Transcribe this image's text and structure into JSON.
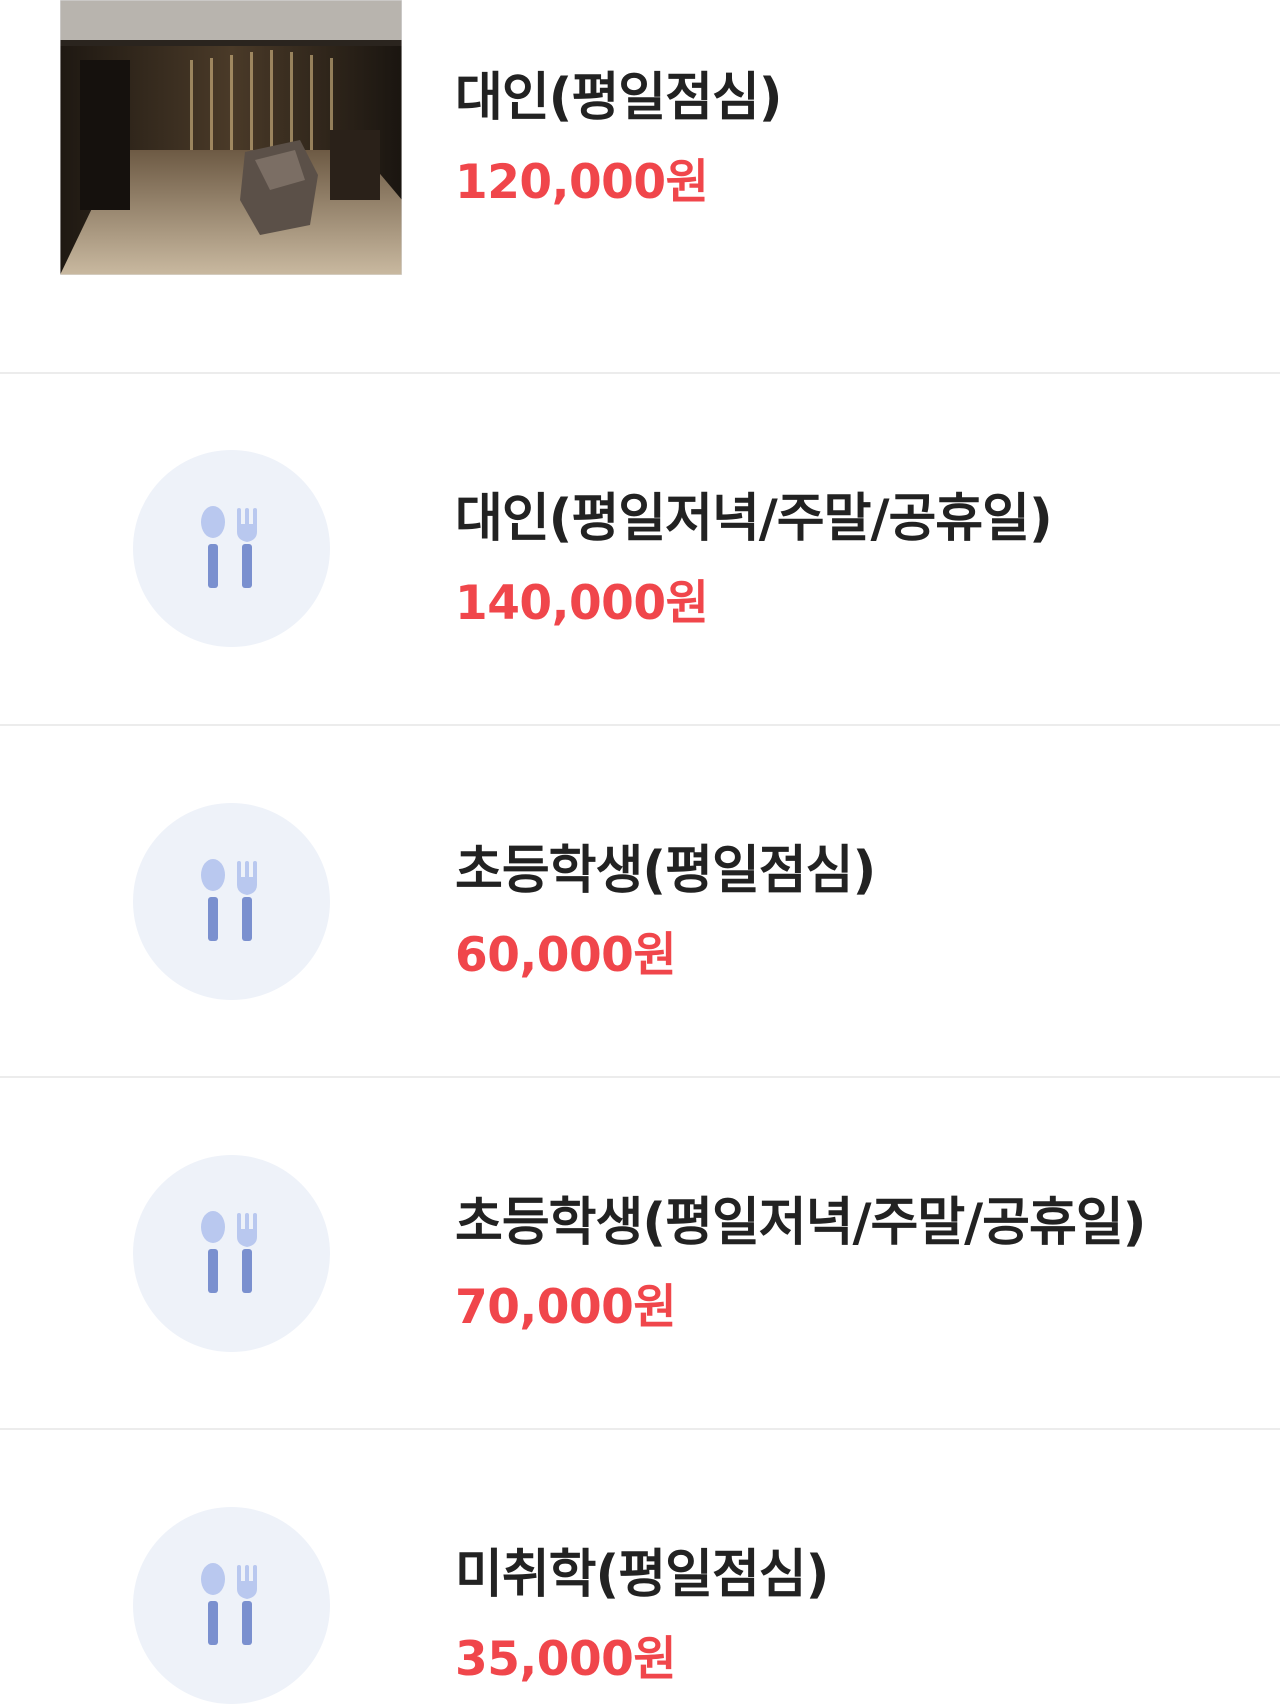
{
  "menu": {
    "currency_suffix": "원",
    "colors": {
      "name_text": "#222222",
      "price_text": "#f0464b",
      "icon_bg": "#eef2f9",
      "icon_fg": "#7a90cf"
    },
    "items": [
      {
        "name": "대인(평일점심)",
        "price": "120,000원",
        "thumbnail": "restaurant-photo"
      },
      {
        "name": "대인(평일저녁/주말/공휴일)",
        "price": "140,000원",
        "thumbnail": "utensils-icon"
      },
      {
        "name": "초등학생(평일점심)",
        "price": "60,000원",
        "thumbnail": "utensils-icon"
      },
      {
        "name": "초등학생(평일저녁/주말/공휴일)",
        "price": "70,000원",
        "thumbnail": "utensils-icon"
      },
      {
        "name": "미취학(평일점심)",
        "price": "35,000원",
        "thumbnail": "utensils-icon"
      }
    ]
  }
}
